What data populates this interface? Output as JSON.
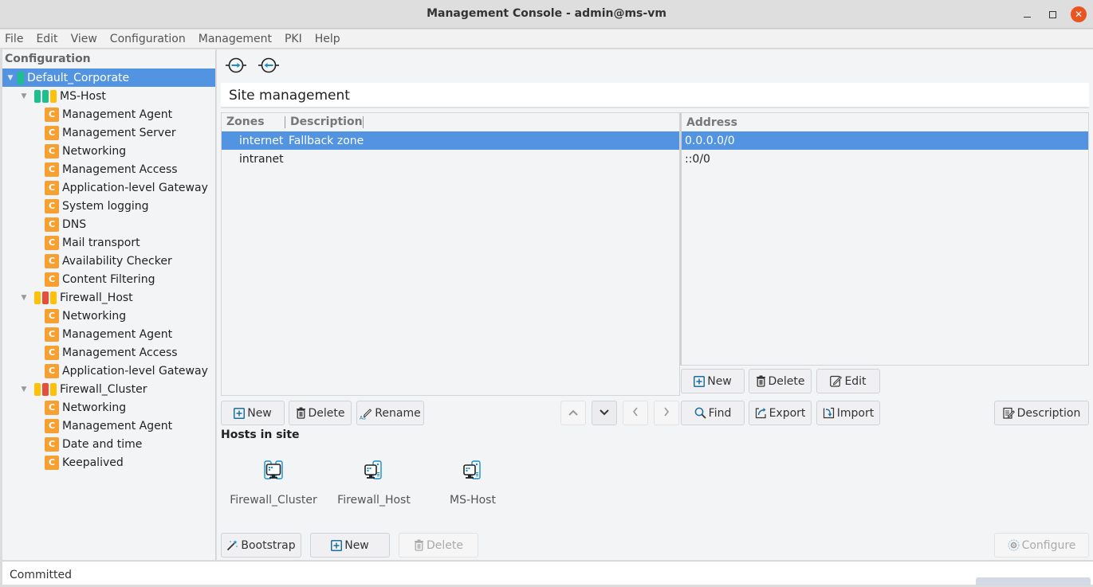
{
  "window": {
    "title": "Management Console - admin@ms-vm",
    "minimize_icon": "minimize-icon",
    "maximize_icon": "maximize-icon",
    "close_icon": "close-icon"
  },
  "menu": [
    "File",
    "Edit",
    "View",
    "Configuration",
    "Management",
    "PKI",
    "Help"
  ],
  "sidebar": {
    "header": "Configuration",
    "tree": [
      {
        "label": "Default_Corporate",
        "level": 0,
        "selected": true,
        "status": [
          "#1dbf8e"
        ]
      },
      {
        "label": "MS-Host",
        "level": 1,
        "status": [
          "#1dbf8e",
          "#1dbf8e",
          "#ffc107"
        ],
        "children": [
          "Management Agent",
          "Management Server",
          "Networking",
          "Management Access",
          "Application-level Gateway",
          "System logging",
          "DNS",
          "Mail transport",
          "Availability Checker",
          "Content Filtering"
        ]
      },
      {
        "label": "Firewall_Host",
        "level": 1,
        "status": [
          "#ffc107",
          "#e74c3c",
          "#ffc107"
        ],
        "children": [
          "Networking",
          "Management Agent",
          "Management Access",
          "Application-level Gateway"
        ]
      },
      {
        "label": "Firewall_Cluster",
        "level": 1,
        "status": [
          "#ffc107",
          "#e74c3c",
          "#ffc107"
        ],
        "children": [
          "Networking",
          "Management Agent",
          "Date and time",
          "Keepalived"
        ]
      }
    ],
    "config_icon_letter": "C"
  },
  "toolbar": {
    "connect_icon": "connect-arrow-right-icon",
    "disconnect_icon": "disconnect-arrow-left-icon"
  },
  "main": {
    "section_title": "Site management",
    "zones": {
      "headers": [
        "Zones",
        "Description"
      ],
      "rows": [
        {
          "zone": "internet",
          "description": "Fallback zone",
          "selected": true
        },
        {
          "zone": "intranet",
          "description": "",
          "selected": false
        }
      ],
      "buttons": {
        "new": "New",
        "delete": "Delete",
        "rename": "Rename"
      }
    },
    "address": {
      "header": "Address",
      "rows": [
        {
          "value": "0.0.0.0/0",
          "selected": true
        },
        {
          "value": "::0/0",
          "selected": false
        }
      ],
      "buttons": {
        "new": "New",
        "delete": "Delete",
        "edit": "Edit"
      }
    },
    "actions": {
      "find": "Find",
      "export": "Export",
      "import": "Import",
      "description": "Description"
    },
    "hosts": {
      "title": "Hosts in site",
      "items": [
        {
          "label": "Firewall_Cluster",
          "icon": "cluster-icon"
        },
        {
          "label": "Firewall_Host",
          "icon": "host-icon"
        },
        {
          "label": "MS-Host",
          "icon": "host-icon"
        }
      ],
      "buttons": {
        "bootstrap": "Bootstrap",
        "new": "New",
        "delete": "Delete",
        "configure": "Configure"
      }
    }
  },
  "status": {
    "text": "Committed"
  },
  "colors": {
    "selection": "#5294e2",
    "config_icon": "#f5a030",
    "close_button": "#e95420"
  }
}
